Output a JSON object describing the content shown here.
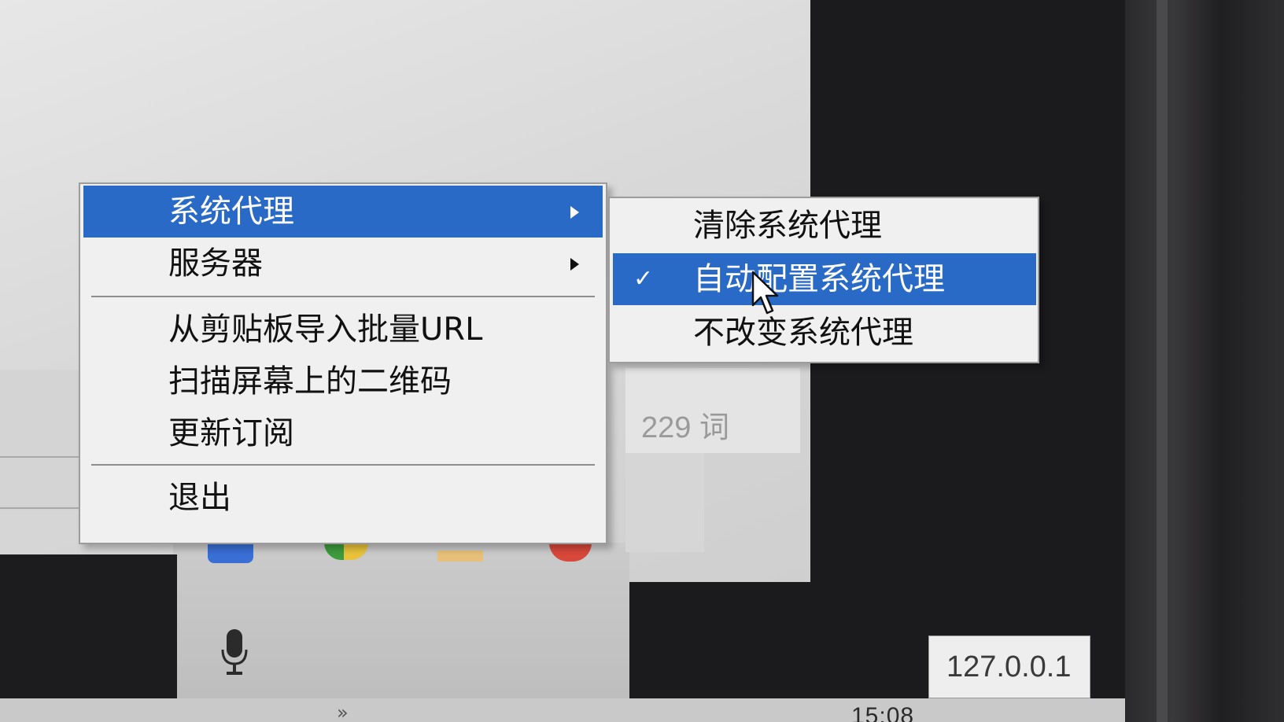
{
  "main_menu": {
    "items": [
      {
        "label": "系统代理",
        "has_submenu": true,
        "highlighted": true
      },
      {
        "label": "服务器",
        "has_submenu": true,
        "highlighted": false
      },
      {
        "label": "从剪贴板导入批量URL",
        "has_submenu": false,
        "highlighted": false
      },
      {
        "label": "扫描屏幕上的二维码",
        "has_submenu": false,
        "highlighted": false
      },
      {
        "label": "更新订阅",
        "has_submenu": false,
        "highlighted": false
      },
      {
        "label": "退出",
        "has_submenu": false,
        "highlighted": false
      }
    ]
  },
  "submenu": {
    "items": [
      {
        "label": "清除系统代理",
        "checked": false,
        "highlighted": false
      },
      {
        "label": "自动配置系统代理",
        "checked": true,
        "highlighted": true
      },
      {
        "label": "不改变系统代理",
        "checked": false,
        "highlighted": false
      }
    ],
    "check_glyph": "✓"
  },
  "status": {
    "word_count": "229 词"
  },
  "tooltip": {
    "text": "127.0.0.1"
  },
  "taskbar": {
    "clock": "15:08",
    "overflow_glyph": "»"
  },
  "colors": {
    "highlight": "#2a6ac7",
    "menu_bg": "#f0f0f0"
  }
}
